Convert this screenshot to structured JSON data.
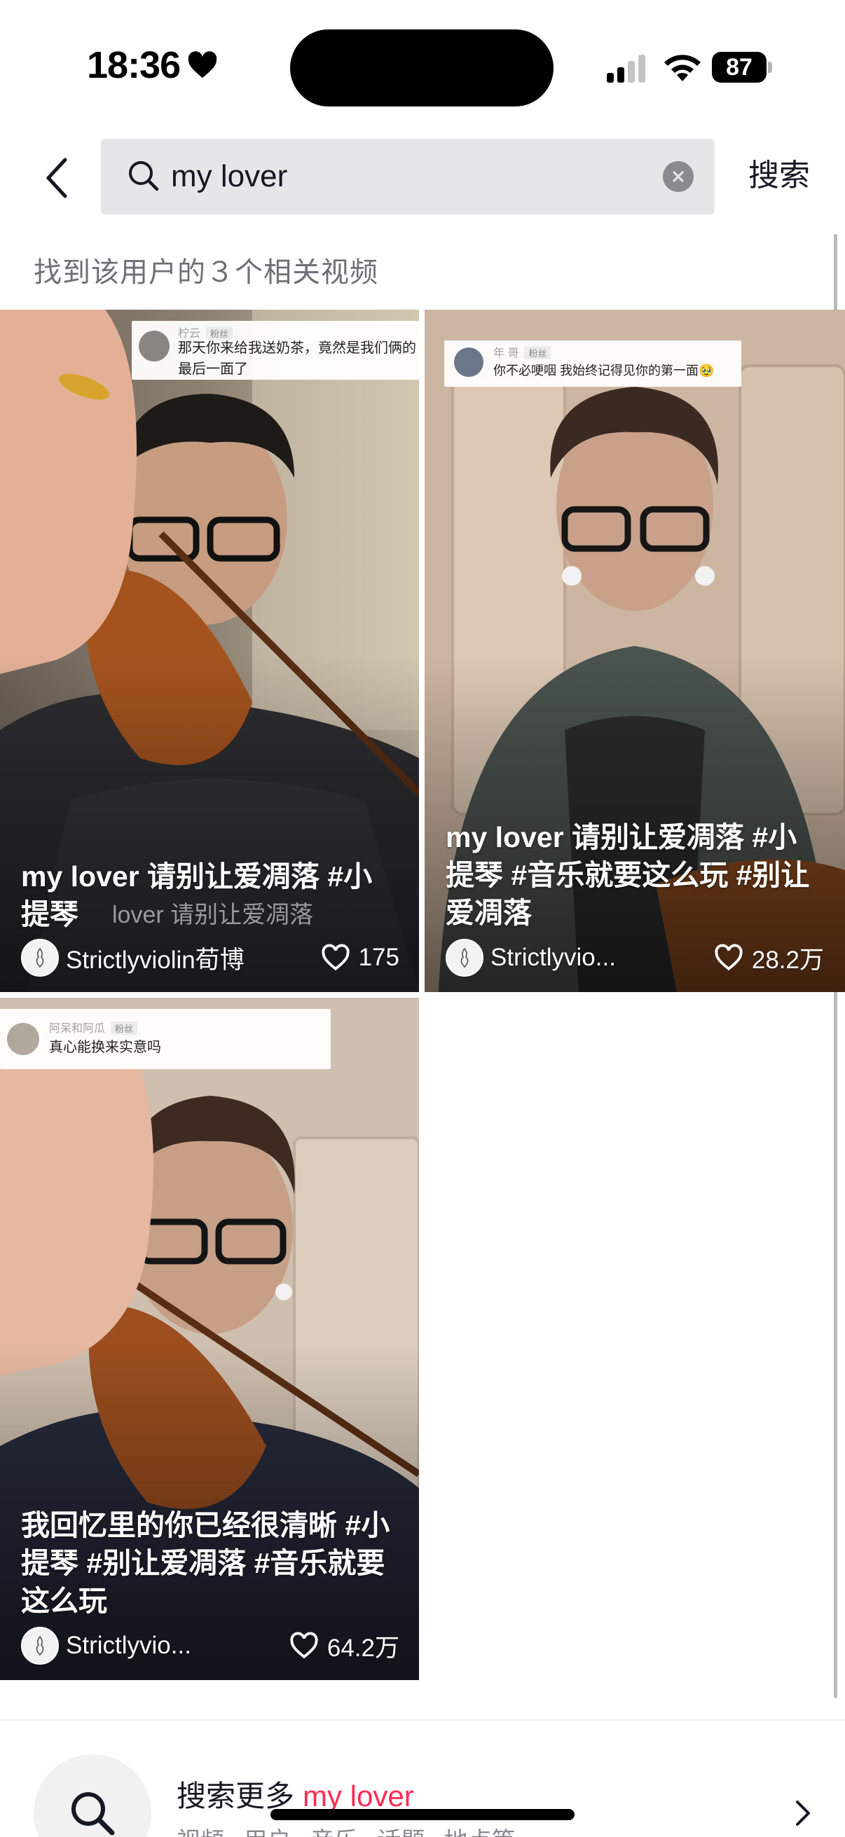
{
  "status_bar": {
    "time": "18:36",
    "battery": "87"
  },
  "search": {
    "query": "my lover",
    "submit_label": "搜索"
  },
  "result_summary": "找到该用户的３个相关视频",
  "videos": [
    {
      "comment_user": "柠云",
      "comment_badge": "粉丝",
      "comment_text": "那天你来给我送奶茶，竟然是我们俩的最后一面了",
      "caption": "my lover 请别让爱凋落 #小提琴",
      "overlay_text": "lover  请别让爱凋落",
      "author": "Strictlyviolin荀博",
      "likes": "175"
    },
    {
      "comment_user": "年    哥",
      "comment_badge": "粉丝",
      "comment_text": "你不必哽咽 我始终记得见你的第一面🥹",
      "caption": "my lover 请别让爱凋落 #小提琴 #音乐就要这么玩 #别让爱凋落",
      "author": "Strictlyvio...",
      "likes": "28.2万"
    },
    {
      "comment_user": "阿呆和阿瓜",
      "comment_badge": "粉丝",
      "comment_text": "真心能换来实意吗",
      "caption": "我回忆里的你已经很清晰 #小提琴 #别让爱凋落 #音乐就要这么玩",
      "author": "Strictlyvio...",
      "likes": "64.2万"
    }
  ],
  "search_more": {
    "prefix": "搜索更多",
    "keyword": "my lover",
    "categories": "视频 用户 音乐 话题 地点等"
  },
  "colors": {
    "accent": "#fe2c55",
    "search_bg": "#e6e6e8",
    "text_primary": "#161823",
    "text_secondary": "#8a8b91"
  }
}
